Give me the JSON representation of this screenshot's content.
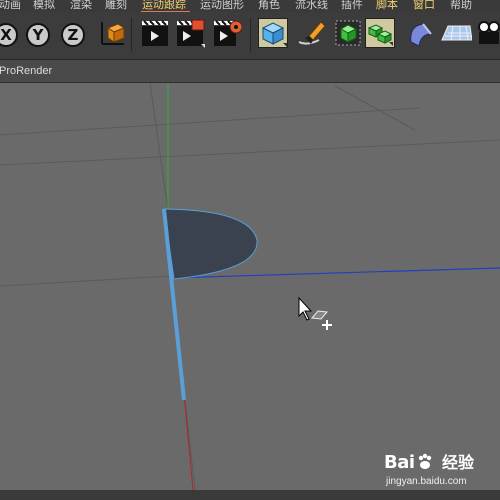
{
  "menu": {
    "items": [
      "动画",
      "模拟",
      "渲染",
      "雕刻",
      "运动跟踪",
      "运动图形",
      "角色",
      "流水线",
      "插件",
      "脚本",
      "窗口",
      "帮助"
    ]
  },
  "toolbar": {
    "axis_x": "X",
    "axis_y": "Y",
    "axis_z": "Z",
    "icons": [
      "x-axis-lock",
      "y-axis-lock",
      "z-axis-lock",
      "world-coordinate",
      "render-view",
      "render-to-picture-viewer",
      "render-settings",
      "cube",
      "pen",
      "subdivision",
      "array",
      "deformer",
      "floor",
      "camera"
    ]
  },
  "viewport": {
    "title": "ProRender",
    "colors": {
      "x_axis": "#c03030",
      "y_axis": "#30b040",
      "z_axis": "#3050c0",
      "selection": "#5a9fd8",
      "shape_fill": "#3a4250"
    }
  },
  "watermark": {
    "logo": "Bai",
    "logo_suffix": "百",
    "chinese": "经验",
    "url": "jingyan.baidu.com"
  }
}
